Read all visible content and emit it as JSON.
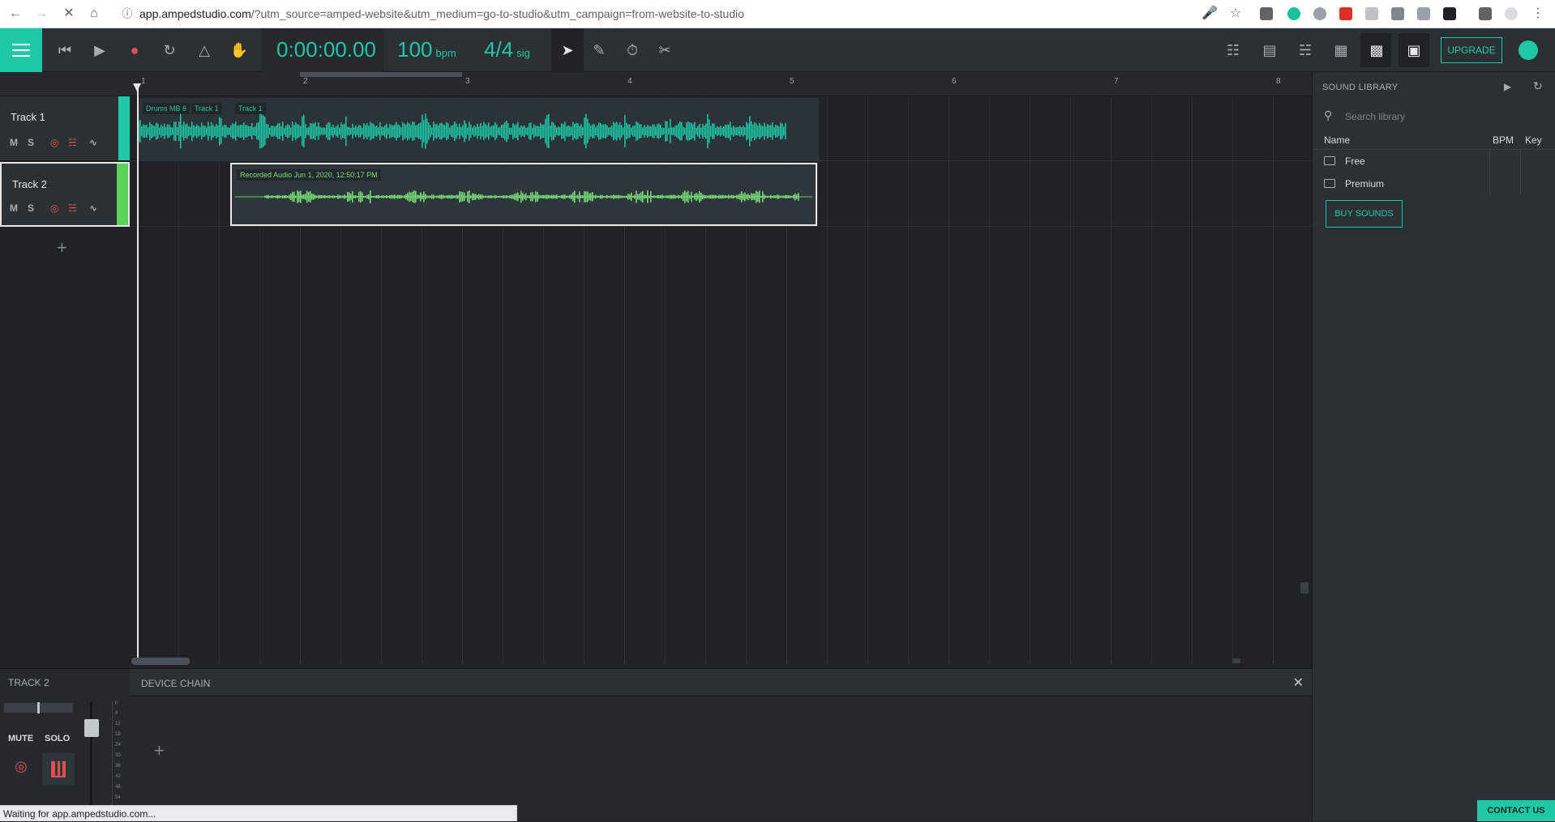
{
  "browser": {
    "url_host": "app.ampedstudio.com",
    "url_rest": "/?utm_source=amped-website&utm_medium=go-to-studio&utm_campaign=from-website-to-studio",
    "status_text": "Waiting for app.ampedstudio.com..."
  },
  "toolbar": {
    "time": "0:00:00.00",
    "tempo": "100",
    "tempo_unit": "bpm",
    "signature": "4/4",
    "signature_unit": "sig",
    "upgrade_label": "UPGRADE"
  },
  "tracks": [
    {
      "name": "Track 1",
      "mute": "M",
      "solo": "S",
      "color": "#1ec8a5"
    },
    {
      "name": "Track 2",
      "mute": "M",
      "solo": "S",
      "color": "#5bd35b"
    }
  ],
  "ruler": {
    "bars": [
      "1",
      "2",
      "3",
      "4",
      "5",
      "6",
      "7",
      "8"
    ]
  },
  "clips": [
    {
      "labels": [
        "Drums MB 6",
        "Track 1",
        "Track 1"
      ],
      "color": "#1ec8a5"
    },
    {
      "labels": [
        "Recorded Audio Jun 1, 2020, 12:50:17 PM"
      ],
      "color": "#7be07b"
    }
  ],
  "library": {
    "title": "SOUND LIBRARY",
    "search_placeholder": "Search library",
    "columns": [
      "Name",
      "BPM",
      "Key"
    ],
    "folders": [
      "Free",
      "Premium"
    ],
    "buy_label": "BUY SOUNDS"
  },
  "bottom_panel": {
    "track_name": "TRACK 2",
    "device_chain_label": "DEVICE CHAIN",
    "mute_label": "MUTE",
    "solo_label": "SOLO",
    "meter_ticks": [
      "0",
      "6",
      "12",
      "18",
      "24",
      "30",
      "36",
      "42",
      "48",
      "54"
    ]
  },
  "contact_label": "CONTACT US"
}
